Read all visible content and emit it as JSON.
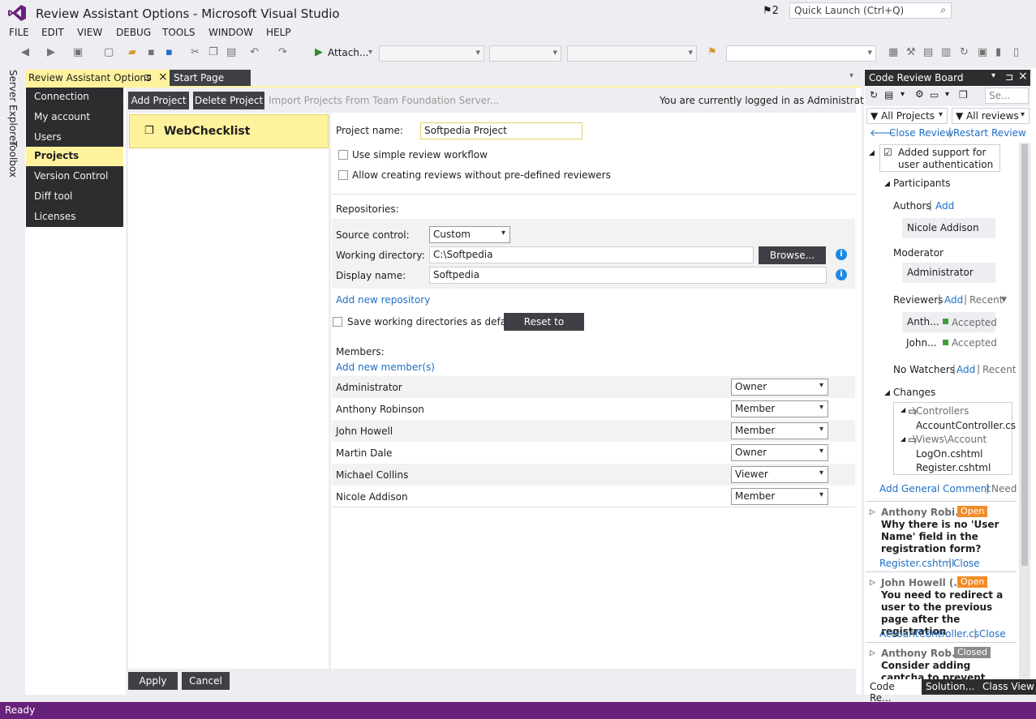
{
  "window": {
    "title": "Review Assistant Options - Microsoft Visual Studio",
    "notifications": "2",
    "quick_launch_placeholder": "Quick Launch (Ctrl+Q)"
  },
  "menu": [
    "FILE",
    "EDIT",
    "VIEW",
    "DEBUG",
    "TOOLS",
    "WINDOW",
    "HELP"
  ],
  "toolbar": {
    "attach_label": "Attach..."
  },
  "side_tabs": [
    "Server Explorer",
    "Toolbox"
  ],
  "doc_tabs": {
    "active": "Review Assistant Options",
    "pin": "⊐",
    "close": "×",
    "inactive": "Start Page"
  },
  "nav": {
    "items": [
      "Connection",
      "My account",
      "Users",
      "Projects",
      "Version Control",
      "Diff tool",
      "Licenses"
    ],
    "selected": "Projects"
  },
  "projects_toolbar": {
    "add": "Add Project",
    "delete": "Delete Project",
    "import": "Import Projects From Team Foundation Server...",
    "login_status": "You are currently logged in as Administrator."
  },
  "project_list": [
    {
      "name": "WebChecklist",
      "selected": true
    }
  ],
  "form": {
    "project_name_label": "Project name:",
    "project_name_value": "Softpedia Project",
    "simple_workflow_label": "Use simple review workflow",
    "allow_no_reviewers_label": "Allow creating reviews without pre-defined reviewers",
    "repositories_label": "Repositories:",
    "source_control_label": "Source control:",
    "source_control_value": "Custom",
    "working_dir_label": "Working directory:",
    "working_dir_value": "C:\\Softpedia",
    "browse_label": "Browse...",
    "display_name_label": "Display name:",
    "display_name_value": "Softpedia",
    "add_repo_link": "Add new repository",
    "save_default_label": "Save working directories as default",
    "reset_label": "Reset to defaults",
    "members_label": "Members:",
    "add_member_link": "Add new member(s)",
    "members": [
      {
        "name": "Administrator",
        "role": "Owner"
      },
      {
        "name": "Anthony Robinson",
        "role": "Member"
      },
      {
        "name": "John Howell",
        "role": "Member"
      },
      {
        "name": "Martin Dale",
        "role": "Owner"
      },
      {
        "name": "Michael Collins",
        "role": "Viewer"
      },
      {
        "name": "Nicole Addison",
        "role": "Member"
      }
    ],
    "apply_label": "Apply",
    "cancel_label": "Cancel"
  },
  "code_review_board": {
    "title": "Code Review Board",
    "search_placeholder": "Se...",
    "filter_projects": "All Projects",
    "filter_reviews": "All reviews",
    "close_review": "Close Review",
    "restart_review": "Restart Review",
    "review_title": "Added support for user authentication",
    "participants_label": "Participants",
    "authors_label": "Authors",
    "add_label": "Add",
    "author_name": "Nicole Addison",
    "moderator_label": "Moderator",
    "moderator_name": "Administrator",
    "reviewers_label": "Reviewers",
    "recent_label": "Recent",
    "reviewers": [
      {
        "name": "Anth...",
        "status": "Accepted"
      },
      {
        "name": "John...",
        "status": "Accepted"
      }
    ],
    "watchers_label": "No Watchers",
    "changes_label": "Changes",
    "changes": [
      {
        "folder": "\\Controllers",
        "files": [
          "AccountController.cs"
        ]
      },
      {
        "folder": "\\Views\\Account",
        "files": [
          "LogOn.cshtml",
          "Register.cshtml"
        ]
      }
    ],
    "add_general_comment": "Add General Comment",
    "need_label": "Need",
    "comments": [
      {
        "author": "Anthony Robi...",
        "status": "Open",
        "text": "Why there is no 'User Name' field in the registration form?",
        "file": "Register.cshtml",
        "action": "Close"
      },
      {
        "author": "John Howell (...",
        "status": "Open",
        "text": "You need to redirect a user to the previous page after the registration",
        "file": "AccountController.cs",
        "action": "Close"
      },
      {
        "author": "Anthony Rob...",
        "status": "Closed",
        "text": "Consider adding captcha to prevent robotic registration",
        "file": "",
        "action": ""
      }
    ],
    "bottom_tabs": [
      "Code Re...",
      "Solution...",
      "Class View"
    ]
  },
  "status": {
    "text": "Ready"
  },
  "colors": {
    "accent_yellow": "#FFF29D",
    "status_purple": "#68217A",
    "badge_open": "#F28C28",
    "badge_closed": "#8A8A8A",
    "accepted_green": "#3C9E3C"
  }
}
